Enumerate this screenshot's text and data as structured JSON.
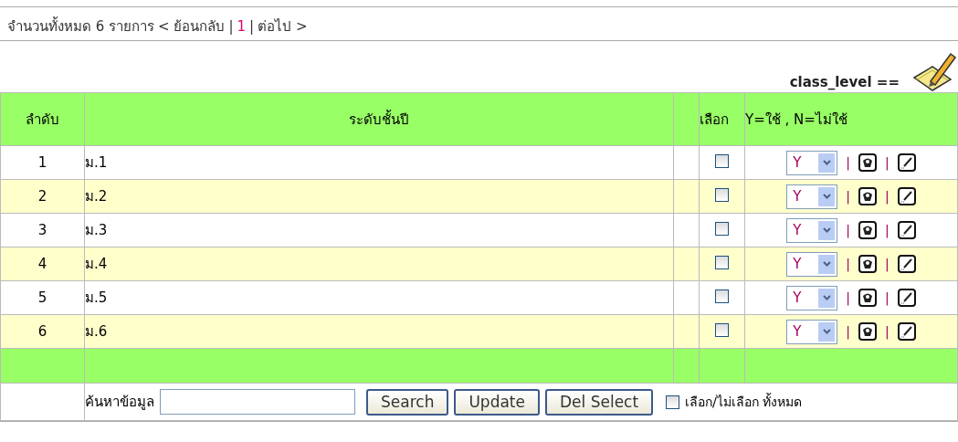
{
  "pager": {
    "total": "จำนวนทั้งหมด 6 รายการ",
    "prev": "< ย้อนกลับ",
    "pages": [
      {
        "label": "1",
        "selected": true
      }
    ],
    "separator": "|",
    "next": "ต่อไป >"
  },
  "table_label": "class_level ==",
  "columns": [
    "ลำดับ",
    "ระดับชั้นปี",
    "",
    "เลือก",
    "Y=ใช้ , N=ไม่ใช้"
  ],
  "rows": [
    {
      "no": "1",
      "level": "ม.1",
      "checked": false,
      "status": "Y",
      "separators": [
        "|",
        "|"
      ]
    },
    {
      "no": "2",
      "level": "ม.2",
      "checked": false,
      "status": "Y",
      "separators": [
        "|",
        "|"
      ]
    },
    {
      "no": "3",
      "level": "ม.3",
      "checked": false,
      "status": "Y",
      "separators": [
        "|",
        "|"
      ]
    },
    {
      "no": "4",
      "level": "ม.4",
      "checked": false,
      "status": "Y",
      "separators": [
        "|",
        "|"
      ]
    },
    {
      "no": "5",
      "level": "ม.5",
      "checked": false,
      "status": "Y",
      "separators": [
        "|",
        "|"
      ]
    },
    {
      "no": "6",
      "level": "ม.6",
      "checked": false,
      "status": "Y",
      "separators": [
        "|",
        "|"
      ]
    }
  ],
  "footer": {
    "search_label": "ค้นหาข้อมูล",
    "buttons": [
      "Search",
      "Update",
      "Del Select"
    ],
    "select_all": {
      "label": "เลือก/ไม่เลือก ทั้งหมด",
      "checked": false
    }
  }
}
